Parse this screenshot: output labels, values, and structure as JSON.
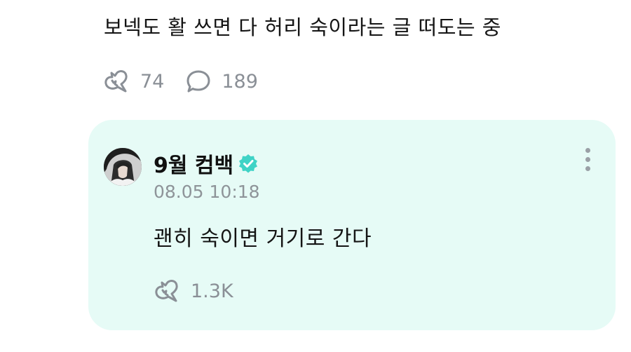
{
  "post": {
    "text": "보넥도 활 쓰면 다 허리 숙이라는 글 떠도는 중",
    "like_count": "74",
    "comment_count": "189"
  },
  "reply": {
    "author": "9월 컴백",
    "verified": true,
    "timestamp": "08.05 10:18",
    "text": "괜히 숙이면 거기로 간다",
    "like_count": "1.3K"
  },
  "colors": {
    "card_background": "#e6fbf6",
    "verified_badge": "#3fd3c6",
    "muted": "#8a8f96"
  },
  "icons": {
    "like": "heart-sparkle-icon",
    "comment": "speech-bubble-icon",
    "more": "more-vertical-icon",
    "verified": "verified-badge-icon"
  }
}
